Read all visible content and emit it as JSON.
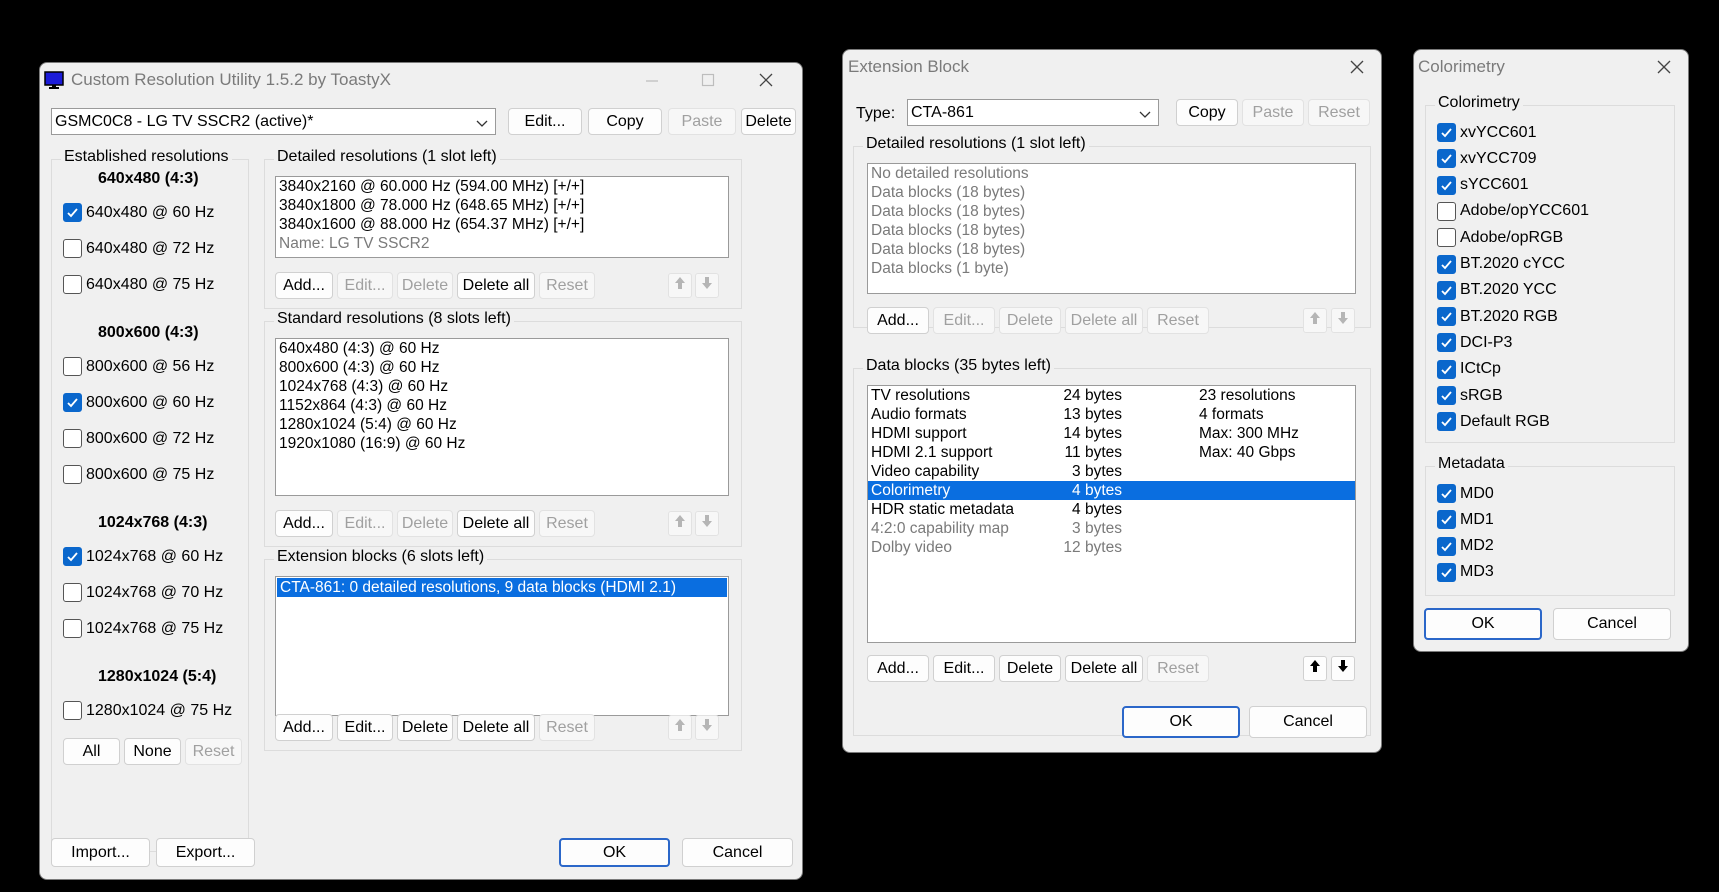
{
  "main": {
    "title": "Custom Resolution Utility 1.5.2 by ToastyX",
    "monitor": "GSMC0C8 - LG TV SSCR2 (active)*",
    "top_buttons": {
      "edit": "Edit...",
      "copy": "Copy",
      "paste": "Paste",
      "delete": "Delete"
    },
    "established": {
      "label": "Established resolutions",
      "groups": [
        {
          "header": "640x480 (4:3)",
          "items": [
            {
              "label": "640x480 @ 60 Hz",
              "checked": true
            },
            {
              "label": "640x480 @ 72 Hz",
              "checked": false
            },
            {
              "label": "640x480 @ 75 Hz",
              "checked": false
            }
          ]
        },
        {
          "header": "800x600 (4:3)",
          "items": [
            {
              "label": "800x600 @ 56 Hz",
              "checked": false
            },
            {
              "label": "800x600 @ 60 Hz",
              "checked": true
            },
            {
              "label": "800x600 @ 72 Hz",
              "checked": false
            },
            {
              "label": "800x600 @ 75 Hz",
              "checked": false
            }
          ]
        },
        {
          "header": "1024x768 (4:3)",
          "items": [
            {
              "label": "1024x768 @ 60 Hz",
              "checked": true
            },
            {
              "label": "1024x768 @ 70 Hz",
              "checked": false
            },
            {
              "label": "1024x768 @ 75 Hz",
              "checked": false
            }
          ]
        },
        {
          "header": "1280x1024 (5:4)",
          "items": [
            {
              "label": "1280x1024 @ 75 Hz",
              "checked": false
            }
          ]
        }
      ],
      "buttons": {
        "all": "All",
        "none": "None",
        "reset": "Reset"
      }
    },
    "detailed": {
      "label": "Detailed resolutions (1 slot left)",
      "rows": [
        "3840x2160 @ 60.000 Hz (594.00 MHz) [+/+]",
        "3840x1800 @ 78.000 Hz (648.65 MHz) [+/+]",
        "3840x1600 @ 88.000 Hz (654.37 MHz) [+/+]",
        "Name: LG TV SSCR2"
      ]
    },
    "standard": {
      "label": "Standard resolutions (8 slots left)",
      "rows": [
        "640x480 (4:3) @ 60 Hz",
        "800x600 (4:3) @ 60 Hz",
        "1024x768 (4:3) @ 60 Hz",
        "1152x864 (4:3) @ 60 Hz",
        "1280x1024 (5:4) @ 60 Hz",
        "1920x1080 (16:9) @ 60 Hz"
      ]
    },
    "extension": {
      "label": "Extension blocks (6 slots left)",
      "rows": [
        "CTA-861: 0 detailed resolutions, 9 data blocks (HDMI 2.1)"
      ]
    },
    "list_buttons": {
      "add": "Add...",
      "edit": "Edit...",
      "delete": "Delete",
      "delete_all": "Delete all",
      "reset": "Reset"
    },
    "import": "Import...",
    "export": "Export...",
    "ok": "OK",
    "cancel": "Cancel"
  },
  "ext": {
    "title": "Extension Block",
    "type_label": "Type:",
    "type_value": "CTA-861",
    "top_buttons": {
      "copy": "Copy",
      "paste": "Paste",
      "reset": "Reset"
    },
    "detailed": {
      "label": "Detailed resolutions (1 slot left)",
      "rows": [
        "No detailed resolutions",
        "Data blocks (18 bytes)",
        "Data blocks (18 bytes)",
        "Data blocks (18 bytes)",
        "Data blocks (18 bytes)",
        "Data blocks (1 byte)"
      ]
    },
    "data_blocks": {
      "label": "Data blocks (35 bytes left)",
      "rows": [
        {
          "name": "TV resolutions",
          "size": "24 bytes",
          "info": "23 resolutions",
          "state": "normal"
        },
        {
          "name": "Audio formats",
          "size": "13 bytes",
          "info": "4 formats",
          "state": "normal"
        },
        {
          "name": "HDMI support",
          "size": "14 bytes",
          "info": "Max: 300 MHz",
          "state": "normal"
        },
        {
          "name": "HDMI 2.1 support",
          "size": "11 bytes",
          "info": "Max: 40 Gbps",
          "state": "normal"
        },
        {
          "name": "Video capability",
          "size": "3 bytes",
          "info": "",
          "state": "normal"
        },
        {
          "name": "Colorimetry",
          "size": "4 bytes",
          "info": "",
          "state": "selected"
        },
        {
          "name": "HDR static metadata",
          "size": "4 bytes",
          "info": "",
          "state": "normal"
        },
        {
          "name": "4:2:0 capability map",
          "size": "3 bytes",
          "info": "",
          "state": "gray"
        },
        {
          "name": "Dolby video",
          "size": "12 bytes",
          "info": "",
          "state": "gray"
        }
      ]
    },
    "list_buttons": {
      "add": "Add...",
      "edit": "Edit...",
      "delete": "Delete",
      "delete_all": "Delete all",
      "reset": "Reset"
    },
    "ok": "OK",
    "cancel": "Cancel"
  },
  "color": {
    "title": "Colorimetry",
    "colorimetry": {
      "label": "Colorimetry",
      "items": [
        {
          "label": "xvYCC601",
          "checked": true
        },
        {
          "label": "xvYCC709",
          "checked": true
        },
        {
          "label": "sYCC601",
          "checked": true
        },
        {
          "label": "Adobe/opYCC601",
          "checked": false
        },
        {
          "label": "Adobe/opRGB",
          "checked": false
        },
        {
          "label": "BT.2020 cYCC",
          "checked": true
        },
        {
          "label": "BT.2020 YCC",
          "checked": true
        },
        {
          "label": "BT.2020 RGB",
          "checked": true
        },
        {
          "label": "DCI-P3",
          "checked": true
        },
        {
          "label": "ICtCp",
          "checked": true
        },
        {
          "label": "sRGB",
          "checked": true
        },
        {
          "label": "Default RGB",
          "checked": true
        }
      ]
    },
    "metadata": {
      "label": "Metadata",
      "items": [
        {
          "label": "MD0",
          "checked": true
        },
        {
          "label": "MD1",
          "checked": true
        },
        {
          "label": "MD2",
          "checked": true
        },
        {
          "label": "MD3",
          "checked": true
        }
      ]
    },
    "ok": "OK",
    "cancel": "Cancel"
  },
  "colors": {
    "accent": "#0a67cc",
    "selection": "#0a6ee0",
    "window_bg": "#f0f0f0",
    "disabled_text": "#a0a0a0"
  }
}
